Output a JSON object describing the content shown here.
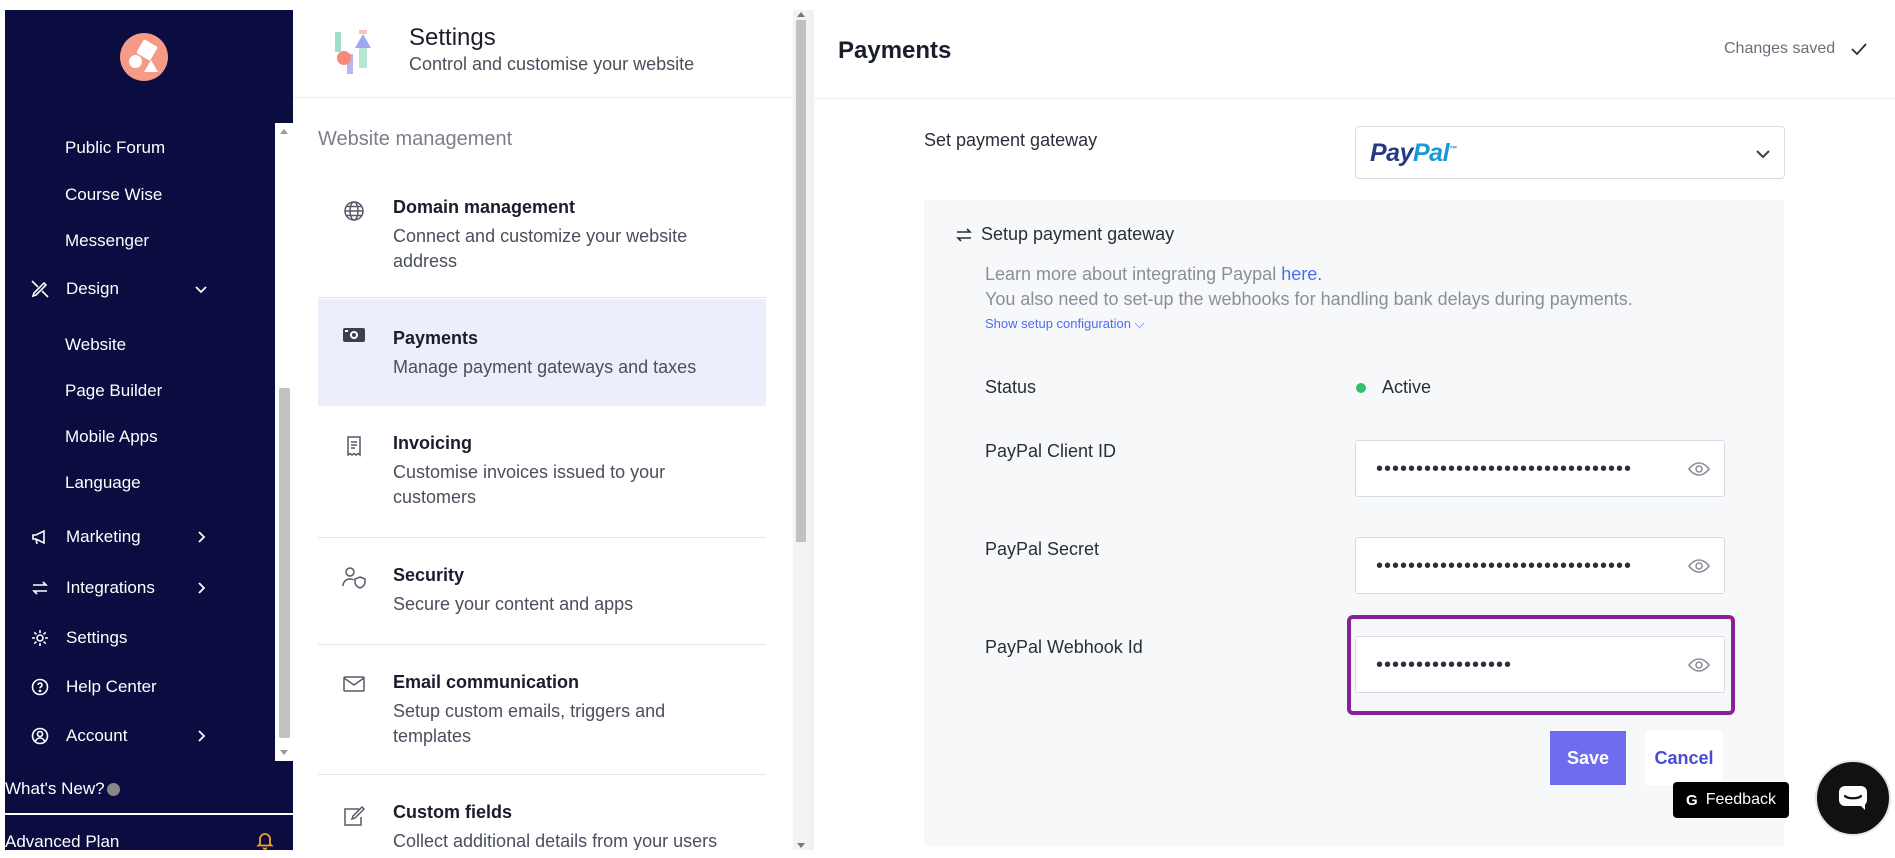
{
  "sidebar": {
    "sub_items_top": [
      "Public Forum",
      "Course Wise",
      "Messenger"
    ],
    "design": {
      "label": "Design",
      "icon": "design-pencil-icon"
    },
    "design_items": [
      "Website",
      "Page Builder",
      "Mobile Apps",
      "Language"
    ],
    "marketing": {
      "label": "Marketing",
      "icon": "megaphone-icon"
    },
    "integrations": {
      "label": "Integrations",
      "icon": "arrows-exchange-icon"
    },
    "settings": {
      "label": "Settings",
      "icon": "gear-icon"
    },
    "help": {
      "label": "Help Center",
      "icon": "question-circle-icon"
    },
    "account": {
      "label": "Account",
      "icon": "user-circle-icon"
    },
    "whats_new": "What's New?",
    "plan": "Advanced Plan"
  },
  "settings_panel": {
    "title": "Settings",
    "subtitle": "Control and customise your website",
    "section": "Website management",
    "items": [
      {
        "title": "Domain management",
        "desc": "Connect and customize your website address",
        "icon": "globe-icon"
      },
      {
        "title": "Payments",
        "desc": "Manage payment gateways and taxes",
        "icon": "money-icon"
      },
      {
        "title": "Invoicing",
        "desc": "Customise invoices issued to your customers",
        "icon": "receipt-icon"
      },
      {
        "title": "Security",
        "desc": "Secure your content and apps",
        "icon": "user-shield-icon"
      },
      {
        "title": "Email communication",
        "desc": "Setup custom emails, triggers and templates",
        "icon": "envelope-icon"
      },
      {
        "title": "Custom fields",
        "desc": "Collect additional details from your users",
        "icon": "edit-form-icon"
      }
    ]
  },
  "payments": {
    "title": "Payments",
    "changes_saved": "Changes saved",
    "gateway_label": "Set payment gateway",
    "gateway_selected": {
      "part1": "Pay",
      "part2": "Pal",
      "tm": "™"
    },
    "setup_title": "Setup payment gateway",
    "learn_prefix": "Learn more about integrating Paypal ",
    "learn_link": "here.",
    "learn_line2": "You also need to set-up the webhooks for handling bank delays during payments.",
    "show_config": "Show setup configuration ⌵",
    "status_label": "Status",
    "status_value": "Active",
    "client_id_label": "PayPal Client ID",
    "client_id_value": "••••••••••••••••••••••••••••••••",
    "secret_label": "PayPal Secret",
    "secret_value": "••••••••••••••••••••••••••••••••",
    "webhook_label": "PayPal Webhook Id",
    "webhook_value": "•••••••••••••••••",
    "save": "Save",
    "cancel": "Cancel"
  },
  "widgets": {
    "feedback_icon": "G",
    "feedback": "Feedback"
  },
  "colors": {
    "sidebar_bg": "#0b0c3f",
    "accent": "#6f6cf0",
    "active_item_bg": "#eceefb",
    "status_active": "#2fc16b",
    "highlight": "#8a2199"
  }
}
